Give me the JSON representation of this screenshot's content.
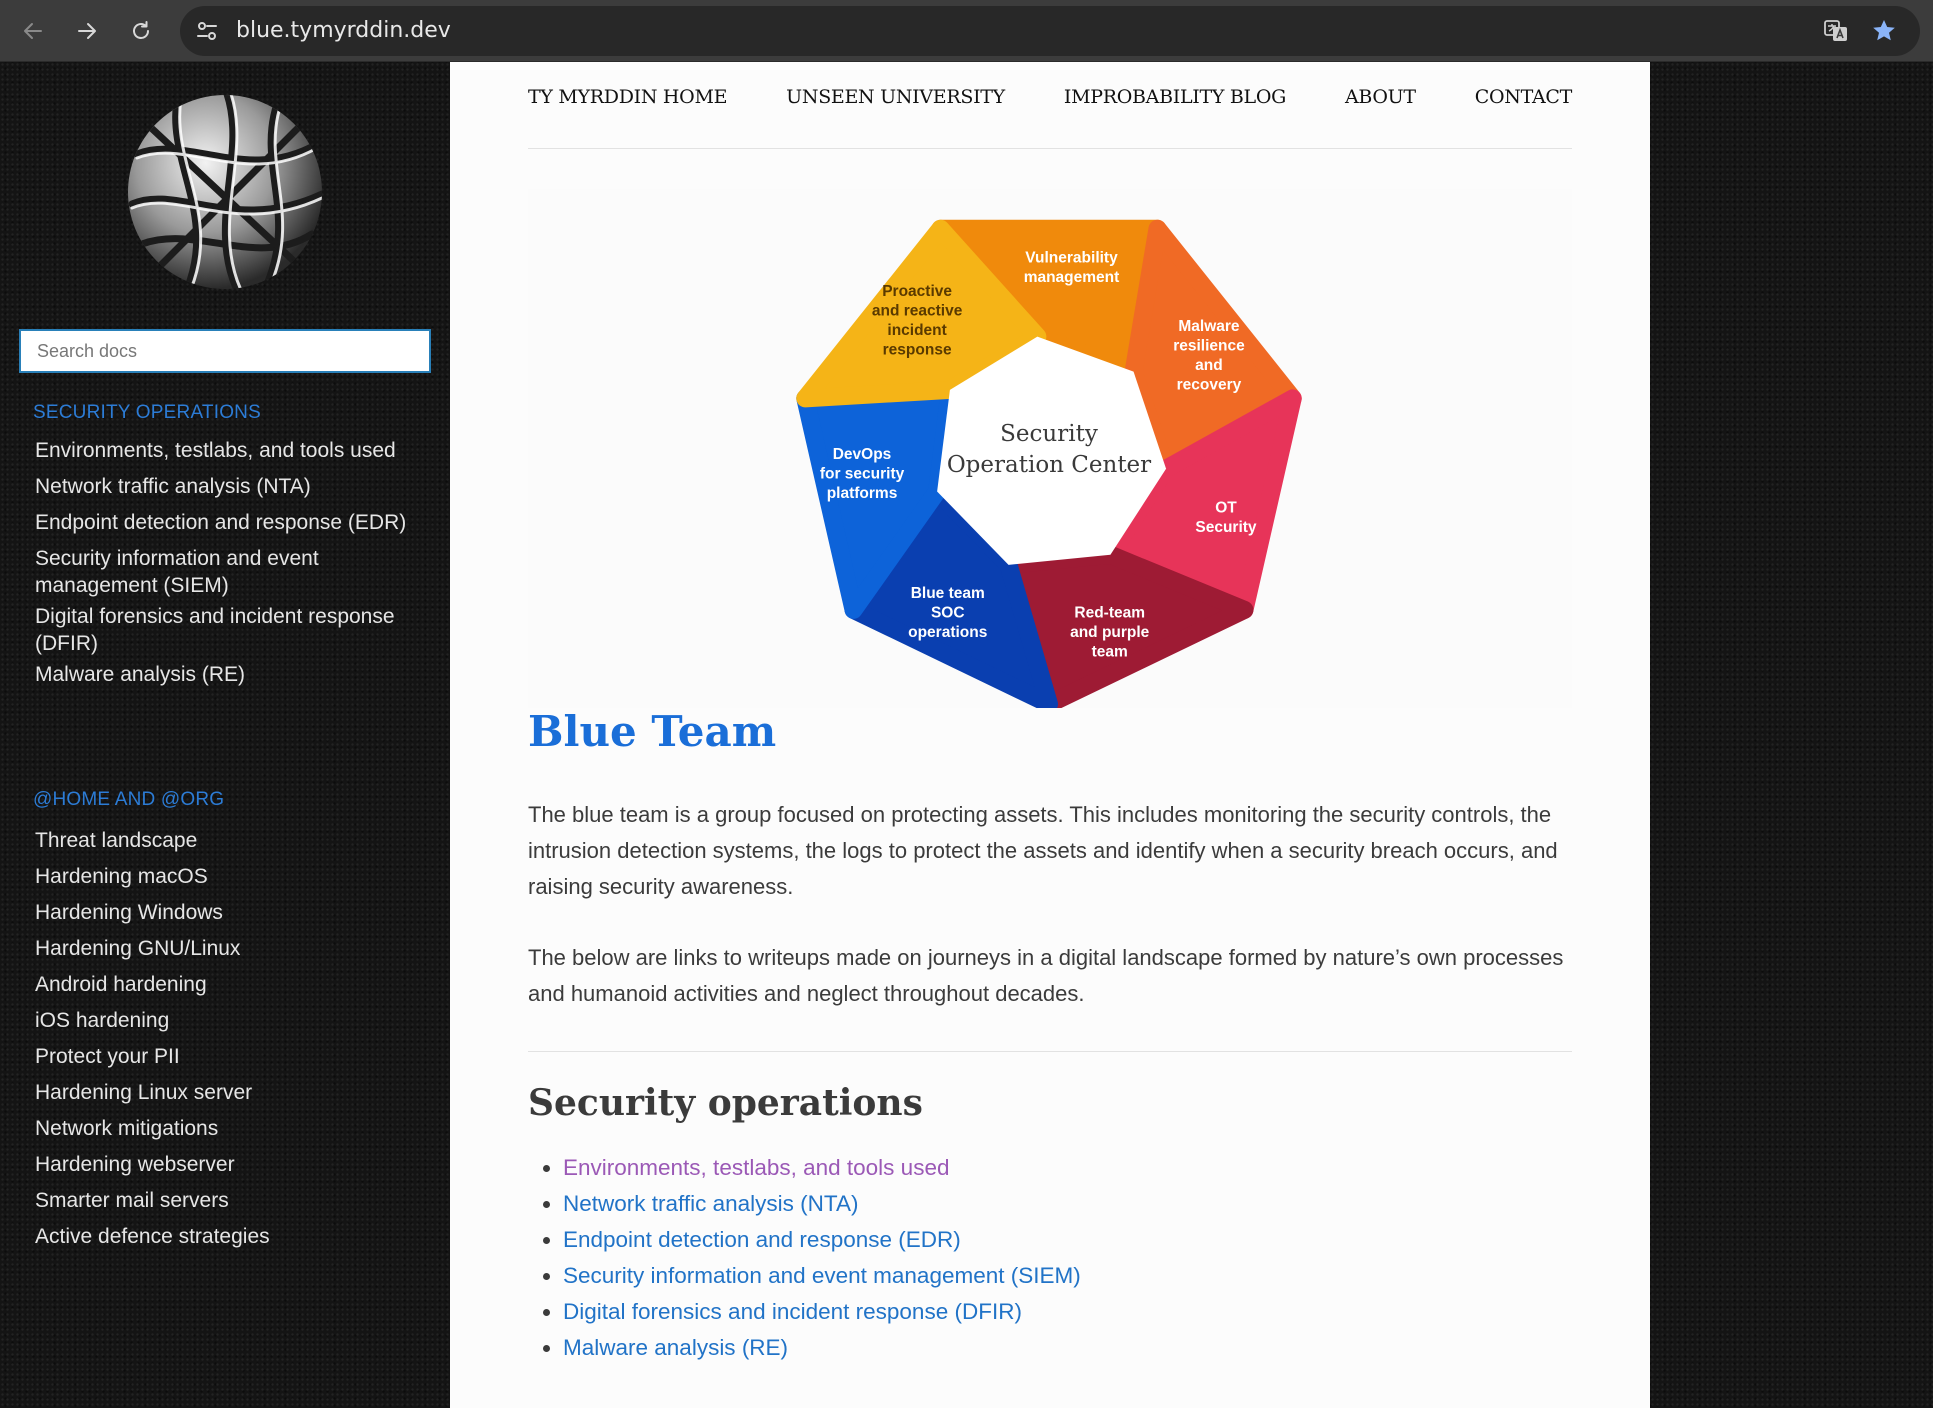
{
  "browser": {
    "url": "blue.tymyrddin.dev"
  },
  "sidebar": {
    "search_placeholder": "Search docs",
    "sections": [
      {
        "caption": "SECURITY OPERATIONS",
        "items": [
          "Environments, testlabs, and tools used",
          "Network traffic analysis (NTA)",
          "Endpoint detection and response (EDR)",
          "Security information and event management (SIEM)",
          "Digital forensics and incident response (DFIR)",
          "Malware analysis (RE)"
        ]
      },
      {
        "caption": "@HOME AND @ORG",
        "items": [
          "Threat landscape",
          "Hardening macOS",
          "Hardening Windows",
          "Hardening GNU/Linux",
          "Android hardening",
          "iOS hardening",
          "Protect your PII",
          "Hardening Linux server",
          "Network mitigations",
          "Hardening webserver",
          "Smarter mail servers",
          "Active defence strategies"
        ]
      }
    ]
  },
  "topnav": [
    "TY MYRDDIN HOME",
    "UNSEEN UNIVERSITY",
    "IMPROBABILITY BLOG",
    "ABOUT",
    "CONTACT"
  ],
  "diagram": {
    "center_line1": "Security",
    "center_line2": "Operation Center",
    "segments": [
      {
        "lines": [
          "Vulnerability",
          "management"
        ],
        "color": "#f08a0c"
      },
      {
        "lines": [
          "Malware",
          "resilience",
          "and",
          "recovery"
        ],
        "color": "#f06a25"
      },
      {
        "lines": [
          "OT",
          "Security"
        ],
        "color": "#e73459"
      },
      {
        "lines": [
          "Red-team",
          "and purple",
          "team"
        ],
        "color": "#9e1b34"
      },
      {
        "lines": [
          "Blue team",
          "SOC",
          "operations"
        ],
        "color": "#0a3fb0"
      },
      {
        "lines": [
          "DevOps",
          "for security",
          "platforms"
        ],
        "color": "#0d63d9"
      },
      {
        "lines": [
          "Proactive",
          "and reactive",
          "incident",
          "response"
        ],
        "color": "#f5b417"
      }
    ]
  },
  "main": {
    "title": "Blue Team",
    "para1": "The blue team is a group focused on protecting assets. This includes monitoring the security controls, the intrusion detection systems, the logs to protect the assets and identify when a security breach occurs, and raising security awareness.",
    "para2": "The below are links to writeups made on journeys in a digital landscape formed by nature’s own processes and humanoid activities and neglect throughout decades.",
    "subtitle": "Security operations",
    "links": [
      "Environments, testlabs, and tools used",
      "Network traffic analysis (NTA)",
      "Endpoint detection and response (EDR)",
      "Security information and event management (SIEM)",
      "Digital forensics and incident response (DFIR)",
      "Malware analysis (RE)"
    ]
  }
}
